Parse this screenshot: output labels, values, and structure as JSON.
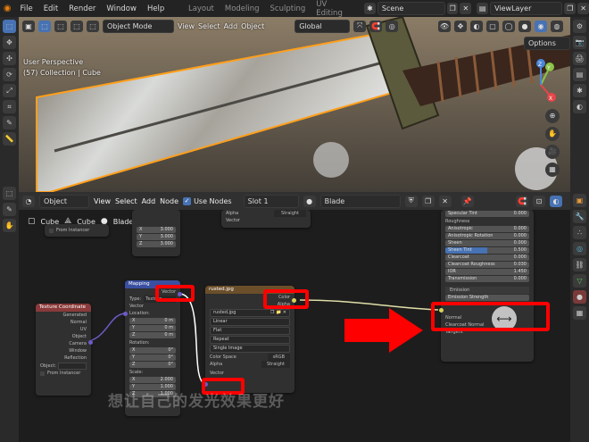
{
  "topbar": {
    "menus": [
      "File",
      "Edit",
      "Render",
      "Window",
      "Help"
    ],
    "workspaces": [
      "Layout",
      "Modeling",
      "Sculpting",
      "UV Editing"
    ],
    "scene": "Scene",
    "view_layer": "ViewLayer"
  },
  "viewport": {
    "mode": "Object Mode",
    "menus": [
      "View",
      "Select",
      "Add",
      "Object"
    ],
    "transform": "Global",
    "options_label": "Options",
    "info_line1": "User Perspective",
    "info_line2": "(57) Collection | Cube",
    "gizmo": {
      "y": "Y",
      "z": "Z",
      "x": "X"
    }
  },
  "node_editor": {
    "editor_type": "Object",
    "menus": [
      "View",
      "Select",
      "Add",
      "Node"
    ],
    "use_nodes_label": "Use Nodes",
    "slot": "Slot 1",
    "material": "Blade",
    "breadcrumb": [
      "Cube",
      "Cube",
      "Blade"
    ]
  },
  "nodes": {
    "texcoord": {
      "title": "Texture Coordinate",
      "outputs": [
        "Generated",
        "Normal",
        "UV",
        "Object",
        "Camera",
        "Window",
        "Reflection"
      ],
      "object_label": "Object:",
      "from_instancer": "From Instancer"
    },
    "top_small": {
      "rows": [
        "X",
        "Y",
        "Z"
      ],
      "values": [
        "3.000",
        "3.000",
        "3.000"
      ],
      "from_instancer": "From Instancer"
    },
    "alpha_node": {
      "alpha_label": "Alpha",
      "alpha_value": "Straight",
      "vector_label": "Vector"
    },
    "mapping": {
      "title": "Mapping",
      "out_vector": "Vector",
      "type_label": "Type:",
      "type_value": "Texture",
      "in_vector": "Vector",
      "location_label": "Location:",
      "location": [
        [
          "X",
          "0 m"
        ],
        [
          "Y",
          "0 m"
        ],
        [
          "Z",
          "0 m"
        ]
      ],
      "rotation_label": "Rotation:",
      "rotation": [
        [
          "X",
          "0°"
        ],
        [
          "Y",
          "0°"
        ],
        [
          "Z",
          "0°"
        ]
      ],
      "scale_label": "Scale:",
      "scale": [
        [
          "X",
          "2.000"
        ],
        [
          "Y",
          "1.000"
        ],
        [
          "Z",
          "1.000"
        ]
      ]
    },
    "image": {
      "title": "rusted.jpg",
      "color_out": "Color",
      "alpha_out": "Alpha",
      "image_name": "rusted.jpg",
      "interp": "Linear",
      "proj": "Flat",
      "ext": "Repeat",
      "source": "Single Image",
      "cs_label": "Color Space",
      "cs_value": "sRGB",
      "alpha_label": "Alpha",
      "alpha_value": "Straight",
      "vector_in": "Vector"
    },
    "bsdf": {
      "rows": [
        [
          "Specular Tint",
          "0.000"
        ],
        [
          "Roughness",
          ""
        ],
        [
          "Anisotropic",
          "0.000"
        ],
        [
          "Anisotropic Rotation",
          "0.000"
        ],
        [
          "Sheen",
          "0.000"
        ],
        [
          "Sheen Tint",
          "0.500"
        ],
        [
          "Clearcoat",
          "0.000"
        ],
        [
          "Clearcoat Roughness",
          "0.030"
        ],
        [
          "IOR",
          "1.450"
        ],
        [
          "Transmission",
          "0.000"
        ]
      ],
      "emission": "Emission",
      "emission_strength": "Emission Strength",
      "normal": "Normal",
      "clearcoat_normal": "Clearcoat Normal",
      "tangent": "Tangent"
    }
  },
  "subtitle": "想让自己的发光效果更好"
}
